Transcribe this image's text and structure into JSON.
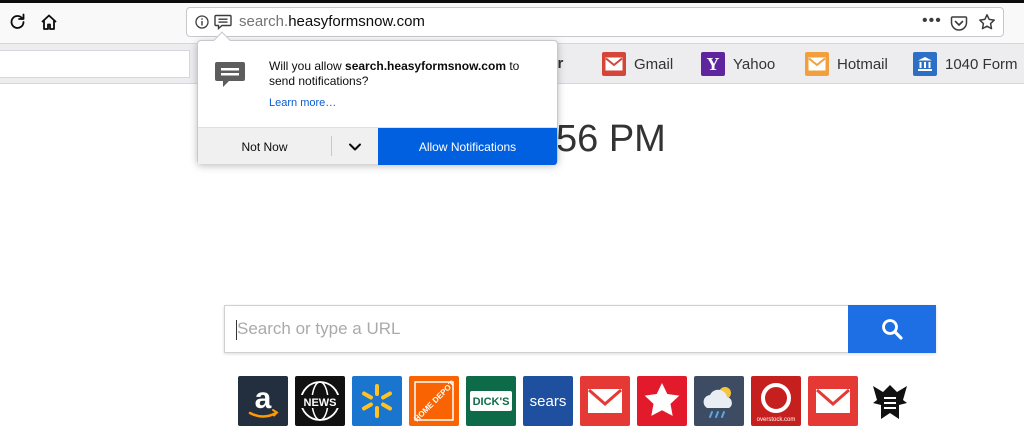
{
  "browser": {
    "url_prefix": "search.",
    "url_domain": "heasyformsnow.com",
    "more_label": "•••"
  },
  "bookmarks": {
    "partial_label": "her",
    "items": [
      {
        "label": "Gmail",
        "icon": "gmail-icon",
        "color": "#d44638"
      },
      {
        "label": "Yahoo",
        "icon": "yahoo-icon",
        "color": "#5f259f"
      },
      {
        "label": "Hotmail",
        "icon": "hotmail-icon",
        "color": "#f2a03d"
      },
      {
        "label": "1040 Form",
        "icon": "bank-icon",
        "color": "#2d6fc4"
      }
    ]
  },
  "clock": {
    "text": "56 PM"
  },
  "search": {
    "placeholder": "Search or type a URL"
  },
  "tiles": [
    {
      "name": "amazon",
      "label": "a",
      "bg": "#232f3e"
    },
    {
      "name": "news",
      "label": "NEWS",
      "bg": "#111111"
    },
    {
      "name": "walmart",
      "label": "",
      "bg": "#1a75cf"
    },
    {
      "name": "home-depot",
      "label": "HOME DEPOT",
      "bg": "#f96302"
    },
    {
      "name": "dicks",
      "label": "DICK'S",
      "bg": "#0e6b4a"
    },
    {
      "name": "sears",
      "label": "sears",
      "bg": "#1f50a0"
    },
    {
      "name": "mail-1",
      "label": "",
      "bg": "#e53935"
    },
    {
      "name": "macys",
      "label": "",
      "bg": "#e21a2c"
    },
    {
      "name": "weather",
      "label": "",
      "bg": "#3e4c63"
    },
    {
      "name": "overstock",
      "label": "overstock.com",
      "bg": "#c6201e"
    },
    {
      "name": "mail-2",
      "label": "",
      "bg": "#e53935"
    },
    {
      "name": "irs",
      "label": "",
      "bg": "#ffffff"
    }
  ],
  "notification": {
    "question_prefix": "Will you allow ",
    "domain": "search.heasyformsnow.com",
    "question_suffix": " to send notifications?",
    "learn_more": "Learn more…",
    "not_now": "Not Now",
    "allow": "Allow Notifications"
  },
  "colors": {
    "accent": "#0060df",
    "search_button": "#1d6fe3"
  }
}
